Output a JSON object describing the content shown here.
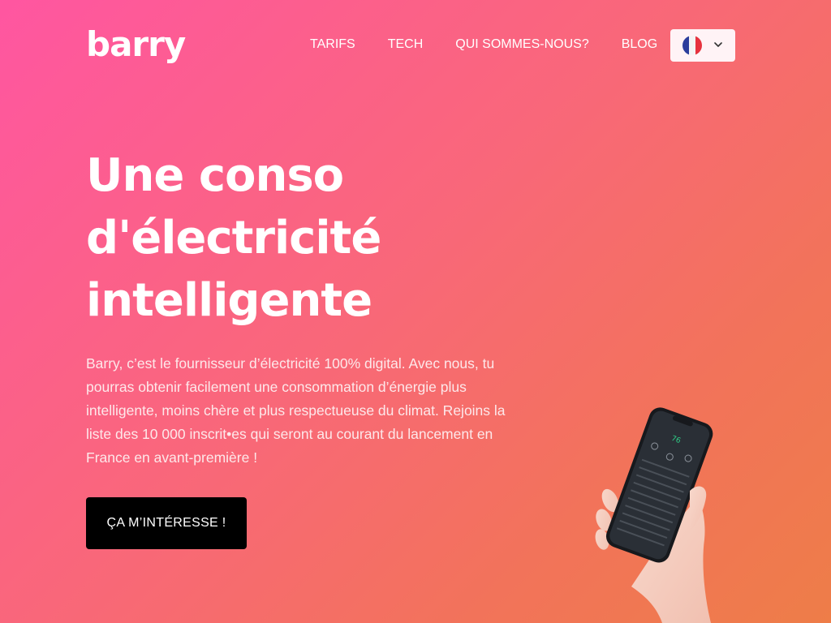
{
  "brand": {
    "logo_text": "barry"
  },
  "nav": {
    "items": [
      {
        "label": "TARIFS"
      },
      {
        "label": "TECH"
      },
      {
        "label": "QUI SOMMES-NOUS?"
      },
      {
        "label": "BLOG"
      }
    ]
  },
  "language_selector": {
    "icon": "france-flag-icon",
    "chevron": "chevron-down-icon"
  },
  "hero": {
    "title_lines": [
      "Une conso",
      "d'électricité",
      "intelligente"
    ],
    "description": "Barry, c’est le fournisseur d’électricité 100% digital. Avec nous, tu pourras obtenir facilement une consommation d’énergie plus intelligente, moins chère et plus respectueuse du climat. Rejoins la liste des 10 000 inscrit•es qui seront au courant du lancement en France en avant-première !",
    "cta_label": "ÇA M’INTÉRESSE !"
  },
  "colors": {
    "gradient_start": "#ff56a1",
    "gradient_end": "#ee7d48",
    "cta_background": "#000000",
    "phone_accent": "#2fd38a"
  }
}
